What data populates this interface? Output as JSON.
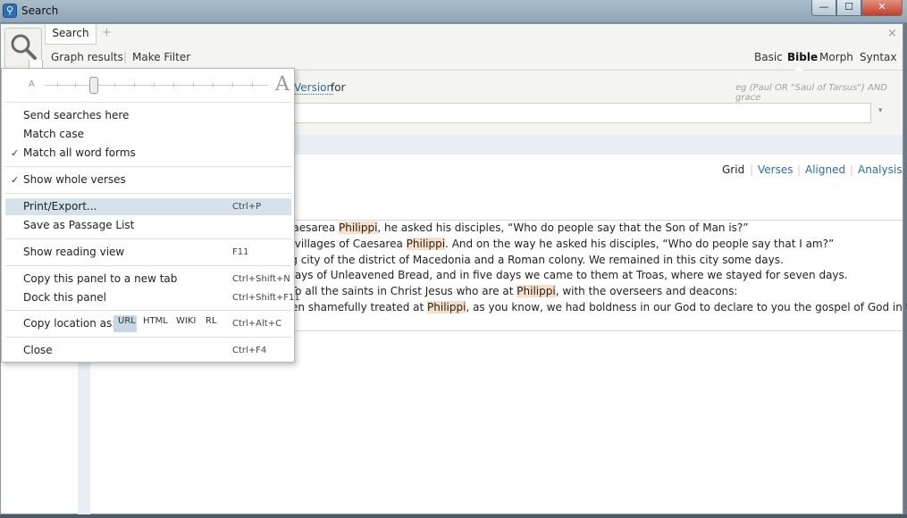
{
  "window": {
    "title": "Search",
    "minimize": "—",
    "maximize": "☐",
    "close": "✕"
  },
  "tabs": {
    "active": "Search",
    "add": "+",
    "close": "×"
  },
  "header": {
    "graph_results": "Graph results",
    "make_filter": "Make Filter",
    "separator": "|",
    "modes": [
      "Basic",
      "Bible",
      "Morph",
      "Syntax"
    ],
    "active_mode": "Bible"
  },
  "query": {
    "version_word": "Version",
    "for_word": "for",
    "example_hint": "eg (Paul OR \"Saul of Tarsus\") AND grace",
    "value": "",
    "dropdown": "▾"
  },
  "views": [
    "Grid",
    "Verses",
    "Aligned",
    "Analysis"
  ],
  "results": [
    {
      "before": "f Caesarea ",
      "match": "Philippi",
      "after": ", he asked his disciples, “Who do people say that the Son of Man is?”"
    },
    {
      "before": "he villages of Caesarea ",
      "match": "Philippi",
      "after": ". And on the way he asked his disciples, “Who do people say that I am?”"
    },
    {
      "before": "ling city of the district of Macedonia and a Roman colony. We remained in this city some days.",
      "match": "",
      "after": ""
    },
    {
      "before": "e days of Unleavened Bread, and in five days we came to them at Troas, where we stayed for seven days.",
      "match": "",
      "after": ""
    },
    {
      "before": "s, To all the saints in Christ Jesus who are at ",
      "match": "Philippi",
      "after": ", with the overseers and deacons:"
    },
    {
      "before": "been shamefully treated at ",
      "match": "Philippi",
      "after": ", as you know, we had boldness in our God to declare to you the gospel of God in the"
    }
  ],
  "menu": {
    "font_small": "A",
    "font_large": "A",
    "font_size_level": 0.22,
    "items": {
      "send_searches_here": "Send searches here",
      "match_case": "Match case",
      "match_all_word_forms": "Match all word forms",
      "show_whole_verses": "Show whole verses",
      "print_export": "Print/Export...",
      "save_passage_list": "Save as Passage List",
      "show_reading_view": "Show reading view",
      "copy_panel_new_tab": "Copy this panel to a new tab",
      "dock_panel": "Dock this panel",
      "copy_location_as": "Copy location as:",
      "close": "Close"
    },
    "checks": {
      "match_all_word_forms": "✓",
      "show_whole_verses": "✓"
    },
    "shortcuts": {
      "print_export": "Ctrl+P",
      "show_reading_view": "F11",
      "copy_panel_new_tab": "Ctrl+Shift+N",
      "dock_panel": "Ctrl+Shift+F11",
      "copy_location_as": "Ctrl+Alt+C",
      "close": "Ctrl+F4"
    },
    "formats": [
      "URL",
      "HTML",
      "WIKI",
      "RL"
    ],
    "active_format": "URL"
  },
  "colors": {
    "highlight": "#f8e0c8",
    "link": "#2e6b9e",
    "menu_hover": "#d6e1ec"
  }
}
